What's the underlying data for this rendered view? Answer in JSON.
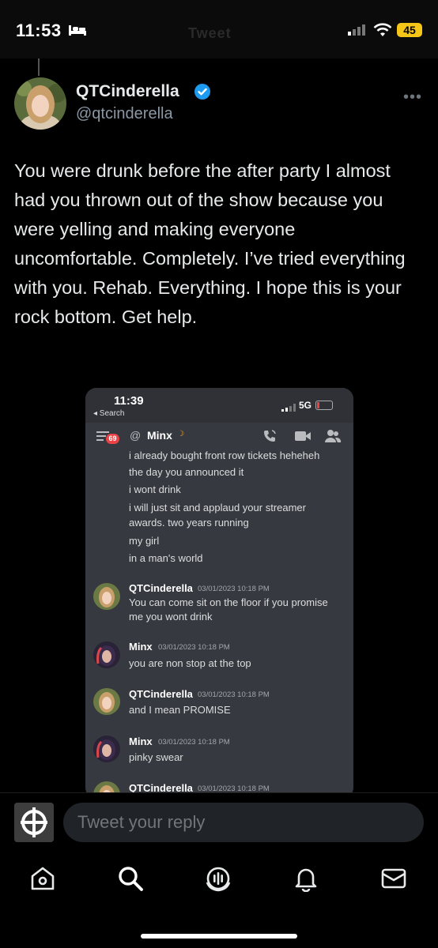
{
  "status_bar": {
    "time": "11:53",
    "faded_title": "Tweet",
    "battery": "45"
  },
  "tweet": {
    "display_name": "QTCinderella",
    "handle": "@qtcinderella",
    "text": "You were drunk before the after party I almost had you thrown out of the show because you were yelling and making everyone uncomfortable. Completely. I’ve tried everything with you. Rehab. Everything. I hope this is your rock bottom. Get help.",
    "more": "•••"
  },
  "embedded_screenshot": {
    "time": "11:39",
    "back_label": "◂ Search",
    "network": "5G",
    "badge_count": "69",
    "channel_prefix": "@",
    "channel_name": "Minx",
    "moon": "☽",
    "continued_lines": [
      "i already bought front row tickets heheheh",
      "the day you announced it",
      "i wont drink",
      "i will just sit and applaud your streamer",
      "awards. two years running",
      "my girl",
      "in a man's world"
    ],
    "messages": [
      {
        "author": "QTCinderella",
        "time": "03/01/2023 10:18 PM",
        "lines": [
          "You can come sit on the floor if you promise",
          "me you wont drink"
        ]
      },
      {
        "author": "Minx",
        "time": "03/01/2023 10:18 PM",
        "lines": [
          "you are non stop at the top"
        ]
      },
      {
        "author": "QTCinderella",
        "time": "03/01/2023 10:18 PM",
        "lines": [
          "and I mean PROMISE"
        ]
      },
      {
        "author": "Minx",
        "time": "03/01/2023 10:18 PM",
        "lines": [
          "pinky swear"
        ]
      },
      {
        "author": "QTCinderella",
        "time": "03/01/2023 10:18 PM",
        "lines": []
      }
    ]
  },
  "reply": {
    "placeholder": "Tweet your reply"
  },
  "tabs": [
    {
      "name": "home",
      "icon": "home-icon"
    },
    {
      "name": "search",
      "icon": "search-icon"
    },
    {
      "name": "spaces",
      "icon": "spaces-icon"
    },
    {
      "name": "notifications",
      "icon": "bell-icon"
    },
    {
      "name": "messages",
      "icon": "mail-icon"
    }
  ],
  "colors": {
    "background": "#000000",
    "verified": "#1d9bf0",
    "discord_bg": "#36393f",
    "badge": "#ed4245",
    "battery": "#f5c518"
  }
}
